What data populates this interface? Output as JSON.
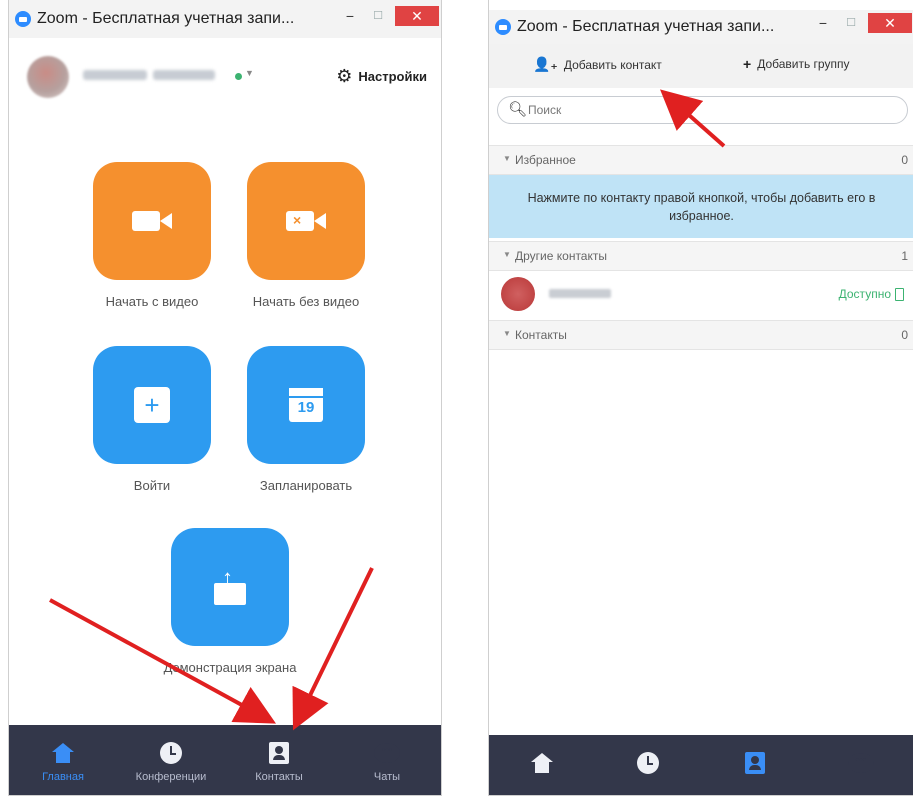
{
  "left_window": {
    "title": "Zoom - Бесплатная учетная запи...",
    "min": "−",
    "max": "☐",
    "close": "✕",
    "settings_label": "Настройки",
    "tiles": [
      {
        "label": "Начать с видео",
        "icon": "video-camera-icon",
        "color": "#f5902e"
      },
      {
        "label": "Начать без видео",
        "icon": "video-off-icon",
        "color": "#f5902e"
      },
      {
        "label": "Войти",
        "icon": "plus-icon",
        "color": "#2d9bf0"
      },
      {
        "label": "Запланировать",
        "icon": "calendar-icon",
        "color": "#2d9bf0",
        "icon_text": "19"
      },
      {
        "label": "Демонстрация экрана",
        "icon": "share-screen-icon",
        "color": "#2d9bf0"
      }
    ],
    "nav": [
      {
        "label": "Главная",
        "icon": "home-icon",
        "active": true
      },
      {
        "label": "Конференции",
        "icon": "clock-icon",
        "active": false
      },
      {
        "label": "Контакты",
        "icon": "contacts-icon",
        "active": false
      },
      {
        "label": "Чаты",
        "icon": "chat-icon",
        "active": false,
        "icon_text": "•••"
      }
    ]
  },
  "right_window": {
    "title": "Zoom - Бесплатная учетная запи...",
    "min": "−",
    "max": "☐",
    "close": "✕",
    "add_contact_label": "Добавить контакт",
    "add_group_label": "Добавить группу",
    "search_placeholder": "Поиск",
    "sections": [
      {
        "label": "Избранное",
        "count": "0"
      },
      {
        "label": "Другие контакты",
        "count": "1"
      },
      {
        "label": "Контакты",
        "count": "0"
      }
    ],
    "favorites_hint": "Нажмите по контакту правой кнопкой, чтобы добавить его в избранное.",
    "contact_status": "Доступно"
  },
  "colors": {
    "accent_blue": "#2d8cff",
    "tile_orange": "#f5902e",
    "tile_blue": "#2d9bf0",
    "nav_bg": "#33374a",
    "status_green": "#3cb371",
    "hint_bg": "#bfe3f6",
    "arrow_red": "#e02020"
  }
}
